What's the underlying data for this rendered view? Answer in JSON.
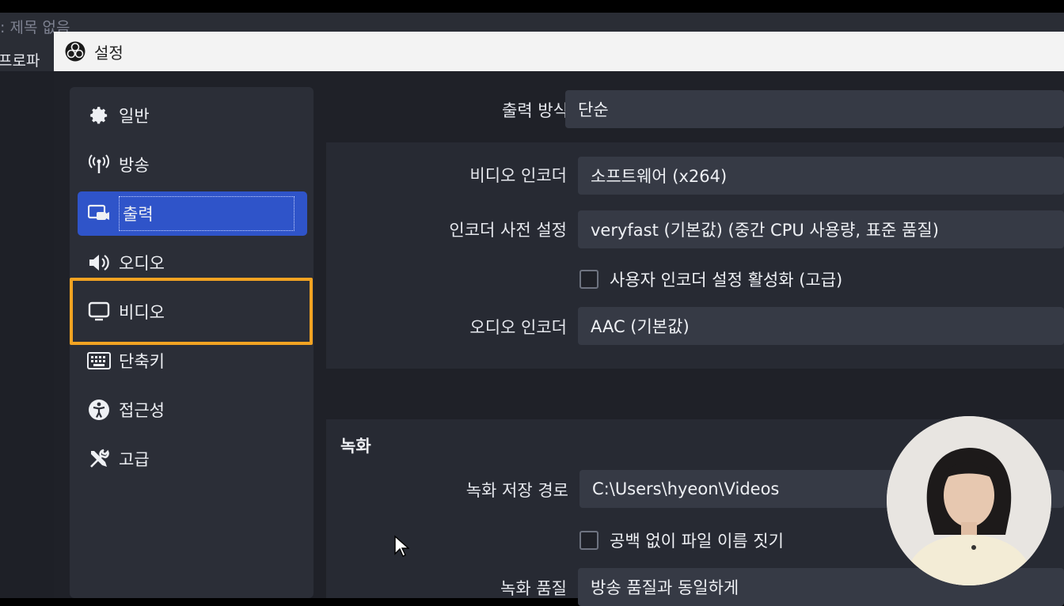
{
  "background_app": {
    "title_fragment": "d: 제목 없음",
    "menu_fragment": "프로파"
  },
  "dialog": {
    "title": "설정",
    "logo_icon": "obs-logo-icon"
  },
  "sidebar": {
    "items": [
      {
        "label": "일반",
        "icon": "gear-icon",
        "active": false
      },
      {
        "label": "방송",
        "icon": "antenna-icon",
        "active": false
      },
      {
        "label": "출력",
        "icon": "output-icon",
        "active": true
      },
      {
        "label": "오디오",
        "icon": "speaker-icon",
        "active": false
      },
      {
        "label": "비디오",
        "icon": "monitor-icon",
        "active": false,
        "highlighted": true
      },
      {
        "label": "단축키",
        "icon": "keyboard-icon",
        "active": false
      },
      {
        "label": "접근성",
        "icon": "accessibility-icon",
        "active": false
      },
      {
        "label": "고급",
        "icon": "tools-icon",
        "active": false
      }
    ],
    "highlight_color": "#f3a322",
    "active_color": "#2f54c9"
  },
  "output": {
    "mode_label": "출력 방식",
    "mode_value": "단순",
    "streaming": {
      "video_encoder_label": "비디오 인코더",
      "video_encoder_value": "소프트웨어 (x264)",
      "preset_label": "인코더 사전 설정",
      "preset_value": "veryfast (기본값) (중간 CPU 사용량, 표준 품질)",
      "custom_encoder_label": "사용자 인코더 설정 활성화 (고급)",
      "custom_encoder_checked": false,
      "audio_encoder_label": "오디오 인코더",
      "audio_encoder_value": "AAC (기본값)"
    },
    "recording": {
      "heading": "녹화",
      "path_label": "녹화 저장 경로",
      "path_value": "C:\\Users\\hyeon\\Videos",
      "no_space_label": "공백 없이 파일 이름 짓기",
      "no_space_checked": false,
      "quality_label": "녹화 품질",
      "quality_value": "방송 품질과 동일하게"
    }
  }
}
